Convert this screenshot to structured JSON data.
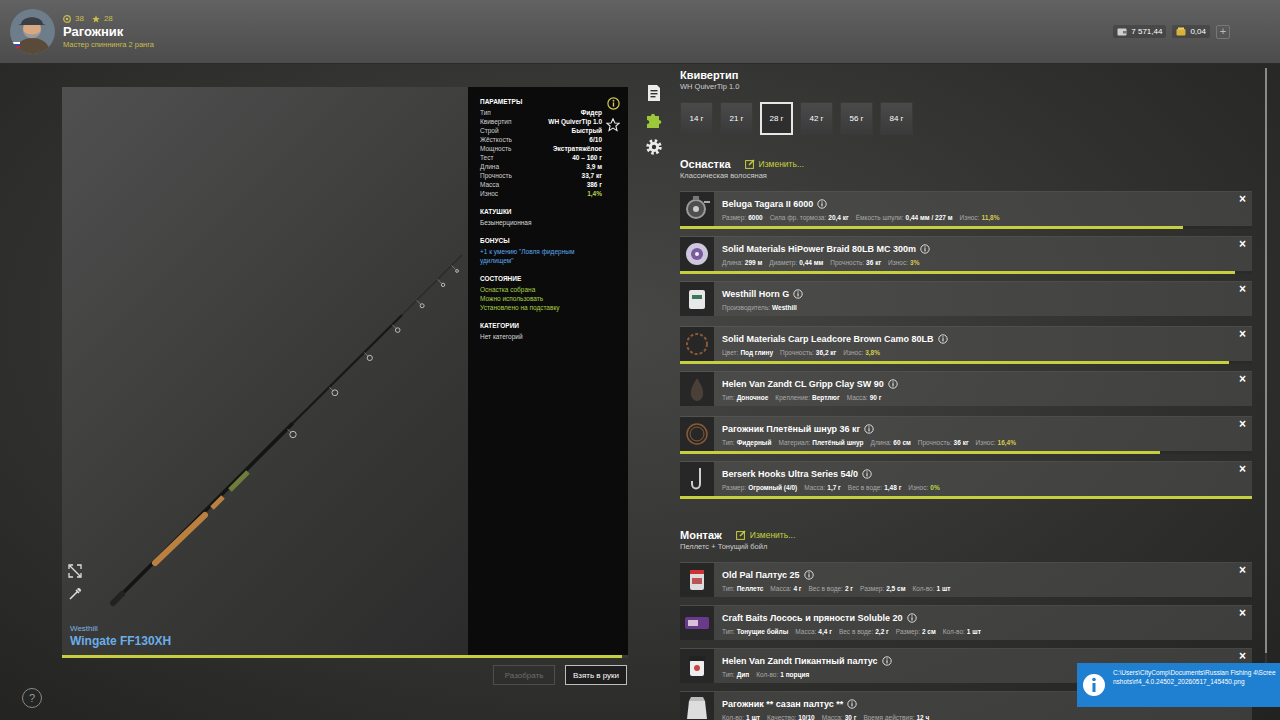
{
  "player": {
    "name": "Рагожник",
    "rank": "Мастер спиннинга 2 ранга",
    "level": "38",
    "stars": "28"
  },
  "currency": {
    "silver": "7 571,44",
    "gold": "0,04",
    "add": "+"
  },
  "rod": {
    "brand": "Westhill",
    "model": "Wingate FF130XH",
    "level": 0.99,
    "params": [
      {
        "title": "ПАРАМЕТРЫ",
        "rows": [
          {
            "label": "Тип",
            "value": "Фидер"
          },
          {
            "label": "Квивертип",
            "value": "WH QuiverTip 1.0"
          },
          {
            "label": "Строй",
            "value": "Быстрый"
          },
          {
            "label": "Жёсткость",
            "value": "6/10"
          },
          {
            "label": "Мощность",
            "value": "Экстратяжёлое"
          },
          {
            "label": "Тест",
            "value": "40 – 160 г"
          },
          {
            "label": "Длина",
            "value": "3,9 м"
          },
          {
            "label": "Прочность",
            "value": "33,7 кг"
          },
          {
            "label": "Масса",
            "value": "386 г"
          },
          {
            "label": "Износ",
            "value": "1,4%",
            "color": "#b8d54a"
          }
        ],
        "lines": []
      },
      {
        "title": "КАТУШКИ",
        "rows": [],
        "lines": [
          {
            "text": "Безынерционная",
            "color": "#d8d8d8"
          }
        ]
      },
      {
        "title": "БОНУСЫ",
        "rows": [],
        "lines": [
          {
            "text": "+1 к умению \"Ловля фидерным удилищем\"",
            "color": "#5aa7e8"
          }
        ]
      },
      {
        "title": "СОСТОЯНИЕ",
        "rows": [],
        "lines": [
          {
            "text": "Оснастка собрана",
            "color": "#a8d04a"
          },
          {
            "text": "Можно использовать",
            "color": "#a8d04a"
          },
          {
            "text": "Установлено на подставку",
            "color": "#a8d04a"
          }
        ]
      },
      {
        "title": "КАТЕГОРИИ",
        "rows": [],
        "lines": [
          {
            "text": "Нет категорий",
            "color": "#d8d8d8"
          }
        ]
      }
    ],
    "buttons": [
      {
        "label": "Разобрать",
        "disabled": true
      },
      {
        "label": "Взять в руки",
        "disabled": false
      }
    ]
  },
  "side_tabs": [
    {
      "kind": "document",
      "selected": false
    },
    {
      "kind": "tackle",
      "selected": true
    },
    {
      "kind": "settings",
      "selected": false
    }
  ],
  "quivertip": {
    "title": "Квивертип",
    "name": "WH QuiverTip 1.0",
    "options": [
      {
        "label": "14 г",
        "selected": false
      },
      {
        "label": "21 г",
        "selected": false
      },
      {
        "label": "28 г",
        "selected": true
      },
      {
        "label": "42 г",
        "selected": false
      },
      {
        "label": "56 г",
        "selected": false
      },
      {
        "label": "84 г",
        "selected": false
      }
    ]
  },
  "rig": {
    "title": "Оснастка",
    "edit": "Изменить...",
    "type": "Классическая волосяная",
    "items": [
      {
        "kind": "reel",
        "name": "Beluga Tagara II 6000",
        "close": "×",
        "level": 0.88,
        "props": [
          {
            "label": "Размер:",
            "value": "6000"
          },
          {
            "label": "Сила фр. тормоза:",
            "value": "20,4 кг"
          },
          {
            "label": "Ёмкость шпули:",
            "value": "0,44 мм / 227 м"
          },
          {
            "label": "Износ:",
            "value": "11,8%",
            "color": "#d6c94e"
          }
        ]
      },
      {
        "kind": "line",
        "name": "Solid Materials HiPower Braid 80LB MC 300m",
        "close": "×",
        "level": 0.97,
        "props": [
          {
            "label": "Длина:",
            "value": "299 м"
          },
          {
            "label": "Диаметр:",
            "value": "0,44 мм"
          },
          {
            "label": "Прочность:",
            "value": "36 кг"
          },
          {
            "label": "Износ:",
            "value": "3%",
            "color": "#d6c94e"
          }
        ]
      },
      {
        "kind": "feeder",
        "name": "Westhill Horn G",
        "close": "×",
        "props": [
          {
            "label": "Производитель:",
            "value": "Westhill"
          }
        ]
      },
      {
        "kind": "leadcore",
        "name": "Solid Materials Carp Leadcore Brown Camo 80LB",
        "close": "×",
        "level": 0.96,
        "props": [
          {
            "label": "Цвет:",
            "value": "Под глину"
          },
          {
            "label": "Прочность:",
            "value": "36,2 кг"
          },
          {
            "label": "Износ:",
            "value": "3,8%",
            "color": "#d6c94e"
          }
        ]
      },
      {
        "kind": "sinker",
        "name": "Helen Van Zandt CL Gripp Clay SW 90",
        "close": "×",
        "props": [
          {
            "label": "Тип:",
            "value": "Доночное"
          },
          {
            "label": "Крепление:",
            "value": "Вертлюг"
          },
          {
            "label": "Масса:",
            "value": "90 г"
          }
        ]
      },
      {
        "kind": "leader",
        "name": "Рагожник Плетёный шнур 36 кг",
        "close": "×",
        "level": 0.84,
        "props": [
          {
            "label": "Тип:",
            "value": "Фидерный"
          },
          {
            "label": "Материал:",
            "value": "Плетёный шнур"
          },
          {
            "label": "Длина:",
            "value": "60 см"
          },
          {
            "label": "Прочность:",
            "value": "36 кг"
          },
          {
            "label": "Износ:",
            "value": "16,4%",
            "color": "#d6c94e"
          }
        ]
      },
      {
        "kind": "hook",
        "name": "Berserk Hooks Ultra Series 54/0",
        "close": "×",
        "level": 1,
        "props": [
          {
            "label": "Размер:",
            "value": "Огромный (4/0)"
          },
          {
            "label": "Масса:",
            "value": "1,7 г"
          },
          {
            "label": "Вес в воде:",
            "value": "1,48 г"
          },
          {
            "label": "Износ:",
            "value": "0%",
            "color": "#b8d54a"
          }
        ]
      }
    ]
  },
  "bait": {
    "title": "Монтаж",
    "edit": "Изменить...",
    "type": "Пеллетс + Тонущий бойл",
    "items": [
      {
        "kind": "pellet",
        "name": "Old Pal Палтус 25",
        "close": "×",
        "props": [
          {
            "label": "Тип:",
            "value": "Пеллетс"
          },
          {
            "label": "Масса:",
            "value": "4 г"
          },
          {
            "label": "Вес в воде:",
            "value": "2 г"
          },
          {
            "label": "Размер:",
            "value": "2,5 см"
          },
          {
            "label": "Кол-во:",
            "value": "1 шт"
          }
        ]
      },
      {
        "kind": "boilie",
        "name": "Craft Baits Лосось и пряности Soluble 20",
        "close": "×",
        "props": [
          {
            "label": "Тип:",
            "value": "Тонущие бойлы"
          },
          {
            "label": "Масса:",
            "value": "4,4 г"
          },
          {
            "label": "Вес в воде:",
            "value": "2,2 г"
          },
          {
            "label": "Размер:",
            "value": "2 см"
          },
          {
            "label": "Кол-во:",
            "value": "1 шт"
          }
        ]
      },
      {
        "kind": "dip",
        "name": "Helen Van Zandt Пикантный палтус",
        "close": "×",
        "props": [
          {
            "label": "Тип:",
            "value": "Дип"
          },
          {
            "label": "Кол-во:",
            "value": "1 порция"
          }
        ]
      },
      {
        "kind": "groundbait",
        "name": "Рагожник ** сазан палтус **",
        "close": "×",
        "props": [
          {
            "label": "Кол-во:",
            "value": "1 шт"
          },
          {
            "label": "Качество:",
            "value": "10/10"
          },
          {
            "label": "Масса:",
            "value": "30 г"
          },
          {
            "label": "Время действия:",
            "value": "12 ч"
          }
        ]
      }
    ]
  },
  "scroll": {
    "level": 0.92
  },
  "help": {
    "label": "?"
  },
  "notification": {
    "text": "C:\\Users\\CityComp\\Documents\\Russian Fishing 4\\Screenshots\\rf4_4.0.24502_20260517_145450.png"
  }
}
